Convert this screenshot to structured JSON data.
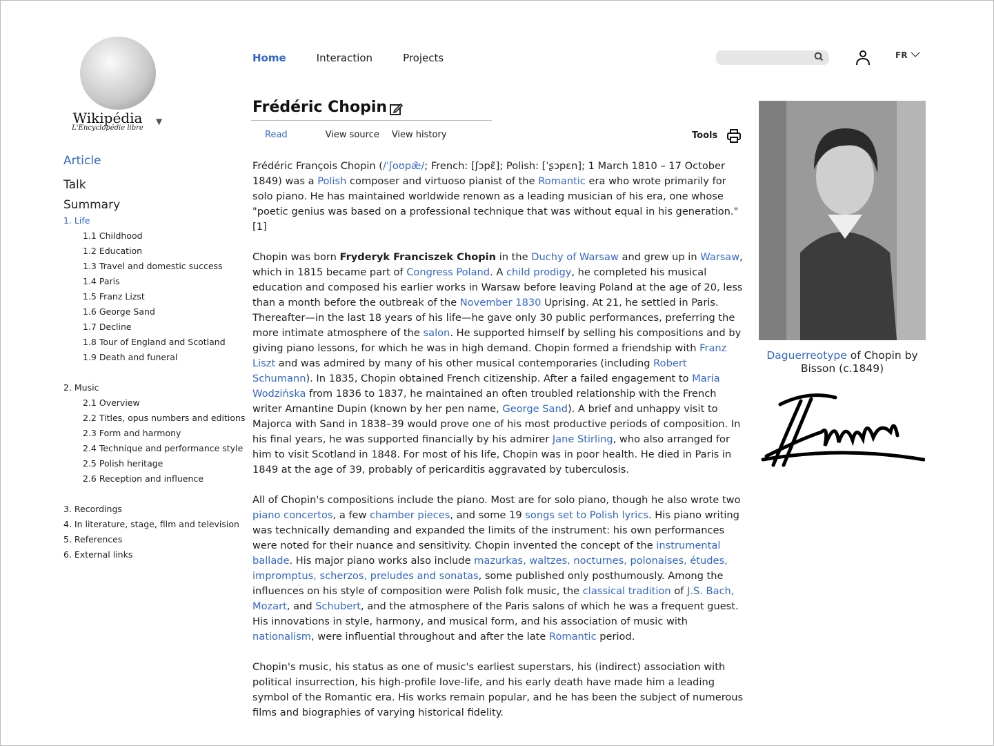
{
  "logo": {
    "wordmark": "Wikipédia",
    "tagline": "L'Encyclopédie libre"
  },
  "topnav": [
    {
      "label": "Home",
      "active": true
    },
    {
      "label": "Interaction"
    },
    {
      "label": "Projects"
    }
  ],
  "search": {
    "placeholder": "",
    "icon": "search-icon"
  },
  "language": "FR",
  "title": "Frédéric Chopin",
  "tabs": {
    "read": "Read",
    "view_source": "View source",
    "view_history": "View history",
    "tools": "Tools"
  },
  "sidebar": {
    "main": [
      "Article",
      "Talk",
      "Summary"
    ],
    "toc": [
      {
        "label": "1. Life",
        "active": true
      },
      {
        "label": "1.1 Childhood",
        "sub": true
      },
      {
        "label": "1.2 Education",
        "sub": true
      },
      {
        "label": "1.3 Travel and domestic success",
        "sub": true
      },
      {
        "label": "1.4 Paris",
        "sub": true
      },
      {
        "label": "1.5 Franz Lizst",
        "sub": true
      },
      {
        "label": "1.6 George Sand",
        "sub": true
      },
      {
        "label": "1.7 Decline",
        "sub": true
      },
      {
        "label": "1.8 Tour of England and Scotland",
        "sub": true
      },
      {
        "label": "1.9 Death and funeral",
        "sub": true
      },
      {
        "gap": true
      },
      {
        "label": "2. Music"
      },
      {
        "label": "2.1 Overview",
        "sub": true
      },
      {
        "label": "2.2 Titles, opus numbers and editions",
        "sub": true
      },
      {
        "label": "2.3 Form and harmony",
        "sub": true
      },
      {
        "label": "2.4 Technique and performance style",
        "sub": true
      },
      {
        "label": "2.5 Polish heritage",
        "sub": true
      },
      {
        "label": "2.6  Reception and influence",
        "sub": true
      },
      {
        "gap": true
      },
      {
        "label": "3. Recordings"
      },
      {
        "label": "4. In literature, stage, film and television"
      },
      {
        "label": "5. References"
      },
      {
        "label": "6. External links"
      }
    ]
  },
  "paragraphs": [
    [
      {
        "t": "Frédéric François Chopin ("
      },
      {
        "t": "/ˈʃoʊpæ̃/",
        "l": 1
      },
      {
        "t": "; French: [ʃɔpɛ̃]; Polish: [ˈʂɔpɛn]; 1 March 1810 – 17 October 1849) was a "
      },
      {
        "t": "Polish",
        "l": 1
      },
      {
        "t": " composer and virtuoso pianist of the "
      },
      {
        "t": "Romantic",
        "l": 1
      },
      {
        "t": " era who wrote primarily for solo piano. He has maintained worldwide renown as a leading musician of his era, one whose \"poetic genius was based on a professional technique that was without equal in his generation.\"[1]"
      }
    ],
    [
      {
        "t": "Chopin was born "
      },
      {
        "t": "Fryderyk Franciszek Chopin",
        "b": 1
      },
      {
        "t": " in the "
      },
      {
        "t": "Duchy of Warsaw",
        "l": 1
      },
      {
        "t": " and grew up in "
      },
      {
        "t": "Warsaw",
        "l": 1
      },
      {
        "t": ", which in 1815 became part of "
      },
      {
        "t": "Congress Poland",
        "l": 1
      },
      {
        "t": ". A "
      },
      {
        "t": "child prodigy",
        "l": 1
      },
      {
        "t": ", he completed his musical education and composed his earlier works in Warsaw before leaving Poland at the age of 20, less than a month before the outbreak of the "
      },
      {
        "t": "November 1830",
        "l": 1
      },
      {
        "t": " Uprising. At 21, he settled in Paris. Thereafter—in the last 18 years of his life—he gave only 30 public performances, preferring the more intimate atmosphere of the "
      },
      {
        "t": "salon",
        "l": 1
      },
      {
        "t": ". He supported himself by selling his compositions and by giving piano lessons, for which he was in high demand. Chopin formed a friendship with "
      },
      {
        "t": "Franz Liszt",
        "l": 1
      },
      {
        "t": " and was admired by many of his other musical contemporaries (including "
      },
      {
        "t": "Robert Schumann",
        "l": 1
      },
      {
        "t": "). In 1835, Chopin obtained French citizenship. After a failed engagement to "
      },
      {
        "t": "Maria Wodzińska",
        "l": 1
      },
      {
        "t": " from 1836 to 1837, he maintained an often troubled relationship with the French writer Amantine Dupin (known by her pen name, "
      },
      {
        "t": "George Sand",
        "l": 1
      },
      {
        "t": "). A brief and unhappy visit to Majorca with Sand in 1838–39 would prove one of his most productive periods of composition. In his final years, he was supported financially by his admirer "
      },
      {
        "t": "Jane Stirling",
        "l": 1
      },
      {
        "t": ", who also arranged for him to visit Scotland in 1848. For most of his life, Chopin was in poor health. He died in Paris in 1849 at the age of 39, probably of pericarditis aggravated by tuberculosis."
      }
    ],
    [
      {
        "t": "All of Chopin's compositions include the piano. Most are for solo piano, though he also wrote two "
      },
      {
        "t": "piano concertos",
        "l": 1
      },
      {
        "t": ", a few "
      },
      {
        "t": "chamber pieces",
        "l": 1
      },
      {
        "t": ", and some 19 "
      },
      {
        "t": "songs set to Polish lyrics",
        "l": 1
      },
      {
        "t": ". His piano writing was technically demanding and expanded the limits of the instrument: his own performances were noted for their nuance and sensitivity. Chopin invented the concept of the "
      },
      {
        "t": "instrumental ballade",
        "l": 1
      },
      {
        "t": ". His major piano works also include "
      },
      {
        "t": "mazurkas, waltzes, nocturnes, polonaises, études, impromptus, scherzos, preludes and sonatas",
        "l": 1
      },
      {
        "t": ", some published only posthumously. Among the influences on his style of composition were Polish folk music, the "
      },
      {
        "t": "classical tradition",
        "l": 1
      },
      {
        "t": " of "
      },
      {
        "t": "J.S. Bach, Mozart",
        "l": 1
      },
      {
        "t": ", and "
      },
      {
        "t": "Schubert",
        "l": 1
      },
      {
        "t": ", and the atmosphere of the Paris salons of which he was a frequent guest. His innovations in style, harmony, and musical form, and his association of music with "
      },
      {
        "t": "nationalism",
        "l": 1
      },
      {
        "t": ", were influential throughout and after the late "
      },
      {
        "t": "Romantic",
        "l": 1
      },
      {
        "t": " period."
      }
    ],
    [
      {
        "t": "Chopin's music, his status as one of music's earliest superstars, his (indirect) association with political insurrection, his high-profile love-life, and his early death have made him a leading symbol of the Romantic era. His works remain popular, and he has been the subject of numerous films and biographies of varying historical fidelity."
      }
    ]
  ],
  "infobox": {
    "caption_link": "Daguerreotype",
    "caption_rest": " of Chopin by Bisson (c.1849)",
    "signature_text": "FChopin"
  },
  "colors": {
    "link": "#3366cc",
    "text": "#202122"
  }
}
